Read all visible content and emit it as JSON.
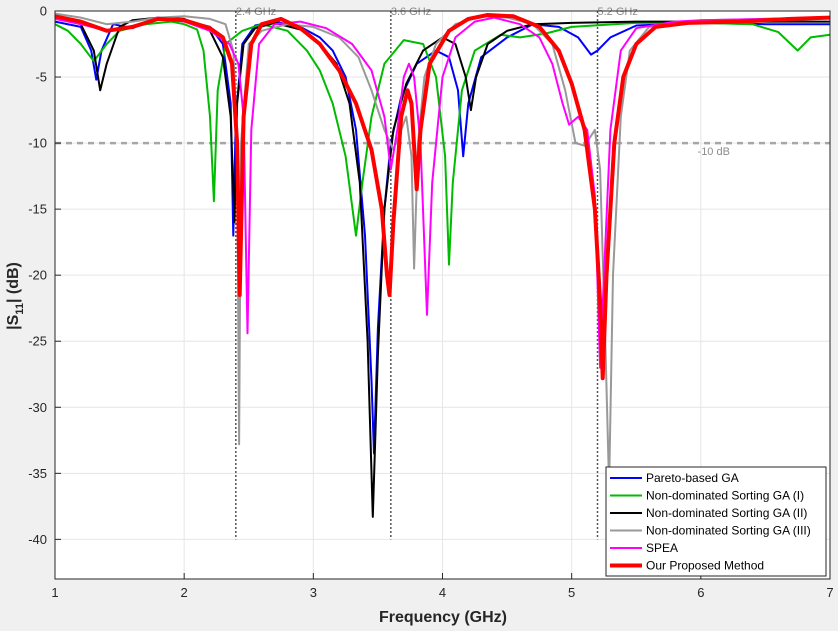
{
  "chart_data": {
    "type": "line",
    "xlabel": "Frequency (GHz)",
    "ylabel_main": "|S",
    "ylabel_sub": "11",
    "ylabel_end": "| (dB)",
    "xlim": [
      1,
      7
    ],
    "ylim": [
      -43,
      0
    ],
    "xticks": [
      "1",
      "2",
      "3",
      "4",
      "5",
      "6",
      "7"
    ],
    "yticks": [
      "0",
      "-5",
      "-10",
      "-15",
      "-20",
      "-25",
      "-30",
      "-35",
      "-40"
    ],
    "grid": true,
    "legend_position": "bottom-right",
    "reference_line": {
      "y": -10,
      "label": "-10 dB",
      "color": "#a6a6a6"
    },
    "markers": [
      {
        "x": 2.4,
        "label": "2.4 GHz"
      },
      {
        "x": 3.6,
        "label": "3.6 GHz"
      },
      {
        "x": 5.2,
        "label": "5.2 GHz"
      }
    ],
    "series": [
      {
        "name": "Pareto-based GA",
        "color": "#0000ff",
        "points": [
          [
            1.0,
            -0.8
          ],
          [
            1.2,
            -1.2
          ],
          [
            1.28,
            -3
          ],
          [
            1.32,
            -5.2
          ],
          [
            1.36,
            -3
          ],
          [
            1.45,
            -1
          ],
          [
            1.6,
            -1.3
          ],
          [
            1.8,
            -0.5
          ],
          [
            2.0,
            -0.7
          ],
          [
            2.2,
            -1.2
          ],
          [
            2.3,
            -2.5
          ],
          [
            2.36,
            -7
          ],
          [
            2.38,
            -17
          ],
          [
            2.4,
            -8
          ],
          [
            2.45,
            -2.5
          ],
          [
            2.55,
            -1.1
          ],
          [
            2.7,
            -0.8
          ],
          [
            2.9,
            -1.2
          ],
          [
            3.05,
            -2
          ],
          [
            3.15,
            -3
          ],
          [
            3.25,
            -5
          ],
          [
            3.33,
            -9
          ],
          [
            3.4,
            -17
          ],
          [
            3.45,
            -28
          ],
          [
            3.47,
            -33.5
          ],
          [
            3.5,
            -24
          ],
          [
            3.55,
            -15
          ],
          [
            3.6,
            -10
          ],
          [
            3.68,
            -6.5
          ],
          [
            3.8,
            -4
          ],
          [
            3.95,
            -3
          ],
          [
            4.05,
            -3.5
          ],
          [
            4.12,
            -6
          ],
          [
            4.16,
            -11
          ],
          [
            4.2,
            -7
          ],
          [
            4.3,
            -3.5
          ],
          [
            4.5,
            -2
          ],
          [
            4.7,
            -1
          ],
          [
            4.9,
            -1.2
          ],
          [
            5.05,
            -2
          ],
          [
            5.15,
            -3.3
          ],
          [
            5.2,
            -3
          ],
          [
            5.3,
            -2
          ],
          [
            5.5,
            -1.1
          ],
          [
            6.0,
            -0.9
          ],
          [
            6.5,
            -1
          ],
          [
            7.0,
            -1
          ]
        ]
      },
      {
        "name": "Non-dominated Sorting GA (I)",
        "color": "#00bb00",
        "points": [
          [
            1.0,
            -1
          ],
          [
            1.1,
            -1.5
          ],
          [
            1.2,
            -2.5
          ],
          [
            1.3,
            -3.8
          ],
          [
            1.4,
            -2.5
          ],
          [
            1.5,
            -1.5
          ],
          [
            1.7,
            -1
          ],
          [
            1.9,
            -0.8
          ],
          [
            2.0,
            -1
          ],
          [
            2.1,
            -1.4
          ],
          [
            2.15,
            -3
          ],
          [
            2.2,
            -8
          ],
          [
            2.23,
            -14.4
          ],
          [
            2.26,
            -6
          ],
          [
            2.32,
            -2.5
          ],
          [
            2.45,
            -1.5
          ],
          [
            2.6,
            -1
          ],
          [
            2.8,
            -1.5
          ],
          [
            2.95,
            -3
          ],
          [
            3.05,
            -4.5
          ],
          [
            3.15,
            -7
          ],
          [
            3.25,
            -11
          ],
          [
            3.33,
            -17
          ],
          [
            3.38,
            -13
          ],
          [
            3.45,
            -8
          ],
          [
            3.55,
            -4
          ],
          [
            3.7,
            -2.2
          ],
          [
            3.85,
            -2.5
          ],
          [
            3.95,
            -5
          ],
          [
            4.02,
            -11
          ],
          [
            4.05,
            -19.2
          ],
          [
            4.08,
            -13
          ],
          [
            4.15,
            -6
          ],
          [
            4.25,
            -3
          ],
          [
            4.45,
            -1.8
          ],
          [
            4.6,
            -2
          ],
          [
            4.8,
            -1.7
          ],
          [
            5.0,
            -1.2
          ],
          [
            5.5,
            -0.9
          ],
          [
            6.0,
            -0.9
          ],
          [
            6.4,
            -1
          ],
          [
            6.6,
            -1.6
          ],
          [
            6.75,
            -3
          ],
          [
            6.85,
            -2
          ],
          [
            7.0,
            -1.8
          ]
        ]
      },
      {
        "name": "Non-dominated Sorting GA (II)",
        "color": "#000000",
        "points": [
          [
            1.0,
            -0.5
          ],
          [
            1.2,
            -1
          ],
          [
            1.3,
            -3
          ],
          [
            1.35,
            -6
          ],
          [
            1.4,
            -4
          ],
          [
            1.5,
            -1.2
          ],
          [
            1.6,
            -0.7
          ],
          [
            1.8,
            -0.5
          ],
          [
            2.0,
            -0.6
          ],
          [
            2.2,
            -1.5
          ],
          [
            2.3,
            -3.5
          ],
          [
            2.36,
            -8
          ],
          [
            2.39,
            -16
          ],
          [
            2.41,
            -7
          ],
          [
            2.46,
            -2.5
          ],
          [
            2.55,
            -1.3
          ],
          [
            2.7,
            -0.9
          ],
          [
            2.9,
            -1.4
          ],
          [
            3.05,
            -2.5
          ],
          [
            3.18,
            -4
          ],
          [
            3.28,
            -7
          ],
          [
            3.36,
            -13
          ],
          [
            3.42,
            -25
          ],
          [
            3.46,
            -38.3
          ],
          [
            3.5,
            -26
          ],
          [
            3.55,
            -15
          ],
          [
            3.62,
            -9
          ],
          [
            3.72,
            -5.5
          ],
          [
            3.85,
            -3
          ],
          [
            4.0,
            -2
          ],
          [
            4.1,
            -2.5
          ],
          [
            4.18,
            -5
          ],
          [
            4.22,
            -7.5
          ],
          [
            4.26,
            -5
          ],
          [
            4.35,
            -2.5
          ],
          [
            4.5,
            -1.5
          ],
          [
            4.7,
            -1
          ],
          [
            5.0,
            -0.9
          ],
          [
            5.5,
            -0.8
          ],
          [
            6.0,
            -0.8
          ],
          [
            6.5,
            -0.8
          ],
          [
            7.0,
            -0.8
          ]
        ]
      },
      {
        "name": "Non-dominated Sorting GA (III)",
        "color": "#999999",
        "points": [
          [
            1.0,
            -0.2
          ],
          [
            1.2,
            -0.5
          ],
          [
            1.4,
            -1
          ],
          [
            1.6,
            -0.8
          ],
          [
            1.8,
            -0.5
          ],
          [
            2.0,
            -0.4
          ],
          [
            2.2,
            -0.6
          ],
          [
            2.32,
            -1
          ],
          [
            2.38,
            -3
          ],
          [
            2.41,
            -10
          ],
          [
            2.425,
            -32.8
          ],
          [
            2.44,
            -10
          ],
          [
            2.5,
            -2.5
          ],
          [
            2.6,
            -1.5
          ],
          [
            2.8,
            -1
          ],
          [
            3.0,
            -1.2
          ],
          [
            3.2,
            -2
          ],
          [
            3.35,
            -3.5
          ],
          [
            3.45,
            -6
          ],
          [
            3.55,
            -9
          ],
          [
            3.62,
            -10.5
          ],
          [
            3.68,
            -9
          ],
          [
            3.72,
            -8
          ],
          [
            3.76,
            -11
          ],
          [
            3.78,
            -19.5
          ],
          [
            3.81,
            -10
          ],
          [
            3.86,
            -5
          ],
          [
            3.95,
            -2.5
          ],
          [
            4.1,
            -1
          ],
          [
            4.3,
            -0.4
          ],
          [
            4.5,
            -0.5
          ],
          [
            4.7,
            -1
          ],
          [
            4.85,
            -2.5
          ],
          [
            4.95,
            -6
          ],
          [
            5.03,
            -10
          ],
          [
            5.1,
            -10.2
          ],
          [
            5.18,
            -9
          ],
          [
            5.22,
            -12
          ],
          [
            5.26,
            -25
          ],
          [
            5.29,
            -36
          ],
          [
            5.32,
            -20
          ],
          [
            5.38,
            -8
          ],
          [
            5.45,
            -3
          ],
          [
            5.6,
            -1.2
          ],
          [
            6.0,
            -0.7
          ],
          [
            6.5,
            -0.6
          ],
          [
            7.0,
            -0.5
          ]
        ]
      },
      {
        "name": "SPEA",
        "color": "#ff00ff",
        "points": [
          [
            1.0,
            -0.6
          ],
          [
            1.2,
            -1
          ],
          [
            1.4,
            -1.5
          ],
          [
            1.6,
            -1.2
          ],
          [
            1.8,
            -0.5
          ],
          [
            2.0,
            -0.8
          ],
          [
            2.2,
            -1.5
          ],
          [
            2.35,
            -2.5
          ],
          [
            2.42,
            -4
          ],
          [
            2.46,
            -8
          ],
          [
            2.49,
            -24.4
          ],
          [
            2.52,
            -9
          ],
          [
            2.58,
            -2.5
          ],
          [
            2.7,
            -1
          ],
          [
            2.9,
            -0.8
          ],
          [
            3.1,
            -1.3
          ],
          [
            3.3,
            -2.5
          ],
          [
            3.45,
            -4.5
          ],
          [
            3.55,
            -8
          ],
          [
            3.6,
            -12
          ],
          [
            3.65,
            -9
          ],
          [
            3.7,
            -5
          ],
          [
            3.74,
            -4
          ],
          [
            3.78,
            -5
          ],
          [
            3.83,
            -10
          ],
          [
            3.88,
            -23
          ],
          [
            3.92,
            -13
          ],
          [
            4.0,
            -5
          ],
          [
            4.1,
            -2
          ],
          [
            4.25,
            -0.8
          ],
          [
            4.4,
            -0.5
          ],
          [
            4.6,
            -1
          ],
          [
            4.75,
            -2
          ],
          [
            4.85,
            -4
          ],
          [
            4.93,
            -7
          ],
          [
            4.98,
            -8.6
          ],
          [
            5.05,
            -8
          ],
          [
            5.12,
            -9
          ],
          [
            5.18,
            -14
          ],
          [
            5.22,
            -27
          ],
          [
            5.25,
            -20
          ],
          [
            5.3,
            -9
          ],
          [
            5.38,
            -3
          ],
          [
            5.5,
            -1.3
          ],
          [
            5.8,
            -0.8
          ],
          [
            6.0,
            -0.7
          ],
          [
            6.5,
            -0.6
          ],
          [
            7.0,
            -0.5
          ]
        ]
      },
      {
        "name": "Our Proposed Method",
        "color": "#ff0000",
        "points": [
          [
            1.0,
            -0.4
          ],
          [
            1.2,
            -0.8
          ],
          [
            1.4,
            -1.5
          ],
          [
            1.6,
            -1.2
          ],
          [
            1.8,
            -0.6
          ],
          [
            2.0,
            -0.7
          ],
          [
            2.2,
            -1.3
          ],
          [
            2.3,
            -2
          ],
          [
            2.37,
            -4
          ],
          [
            2.41,
            -10
          ],
          [
            2.43,
            -21.5
          ],
          [
            2.46,
            -8
          ],
          [
            2.52,
            -2.5
          ],
          [
            2.6,
            -1
          ],
          [
            2.75,
            -0.6
          ],
          [
            2.9,
            -1.3
          ],
          [
            3.05,
            -2.5
          ],
          [
            3.2,
            -4.5
          ],
          [
            3.33,
            -7
          ],
          [
            3.45,
            -10.5
          ],
          [
            3.53,
            -15
          ],
          [
            3.57,
            -20
          ],
          [
            3.59,
            -21.5
          ],
          [
            3.62,
            -16
          ],
          [
            3.68,
            -8
          ],
          [
            3.73,
            -6
          ],
          [
            3.76,
            -7
          ],
          [
            3.8,
            -13.5
          ],
          [
            3.83,
            -9
          ],
          [
            3.9,
            -4
          ],
          [
            4.05,
            -1.5
          ],
          [
            4.2,
            -0.6
          ],
          [
            4.35,
            -0.3
          ],
          [
            4.55,
            -0.4
          ],
          [
            4.75,
            -1.2
          ],
          [
            4.9,
            -3
          ],
          [
            5.0,
            -5.5
          ],
          [
            5.1,
            -9
          ],
          [
            5.18,
            -15
          ],
          [
            5.22,
            -22
          ],
          [
            5.24,
            -27.8
          ],
          [
            5.27,
            -20
          ],
          [
            5.33,
            -10
          ],
          [
            5.4,
            -5
          ],
          [
            5.5,
            -2.5
          ],
          [
            5.65,
            -1.2
          ],
          [
            5.9,
            -0.9
          ],
          [
            6.3,
            -0.8
          ],
          [
            6.7,
            -0.6
          ],
          [
            7.0,
            -0.5
          ]
        ]
      }
    ]
  }
}
